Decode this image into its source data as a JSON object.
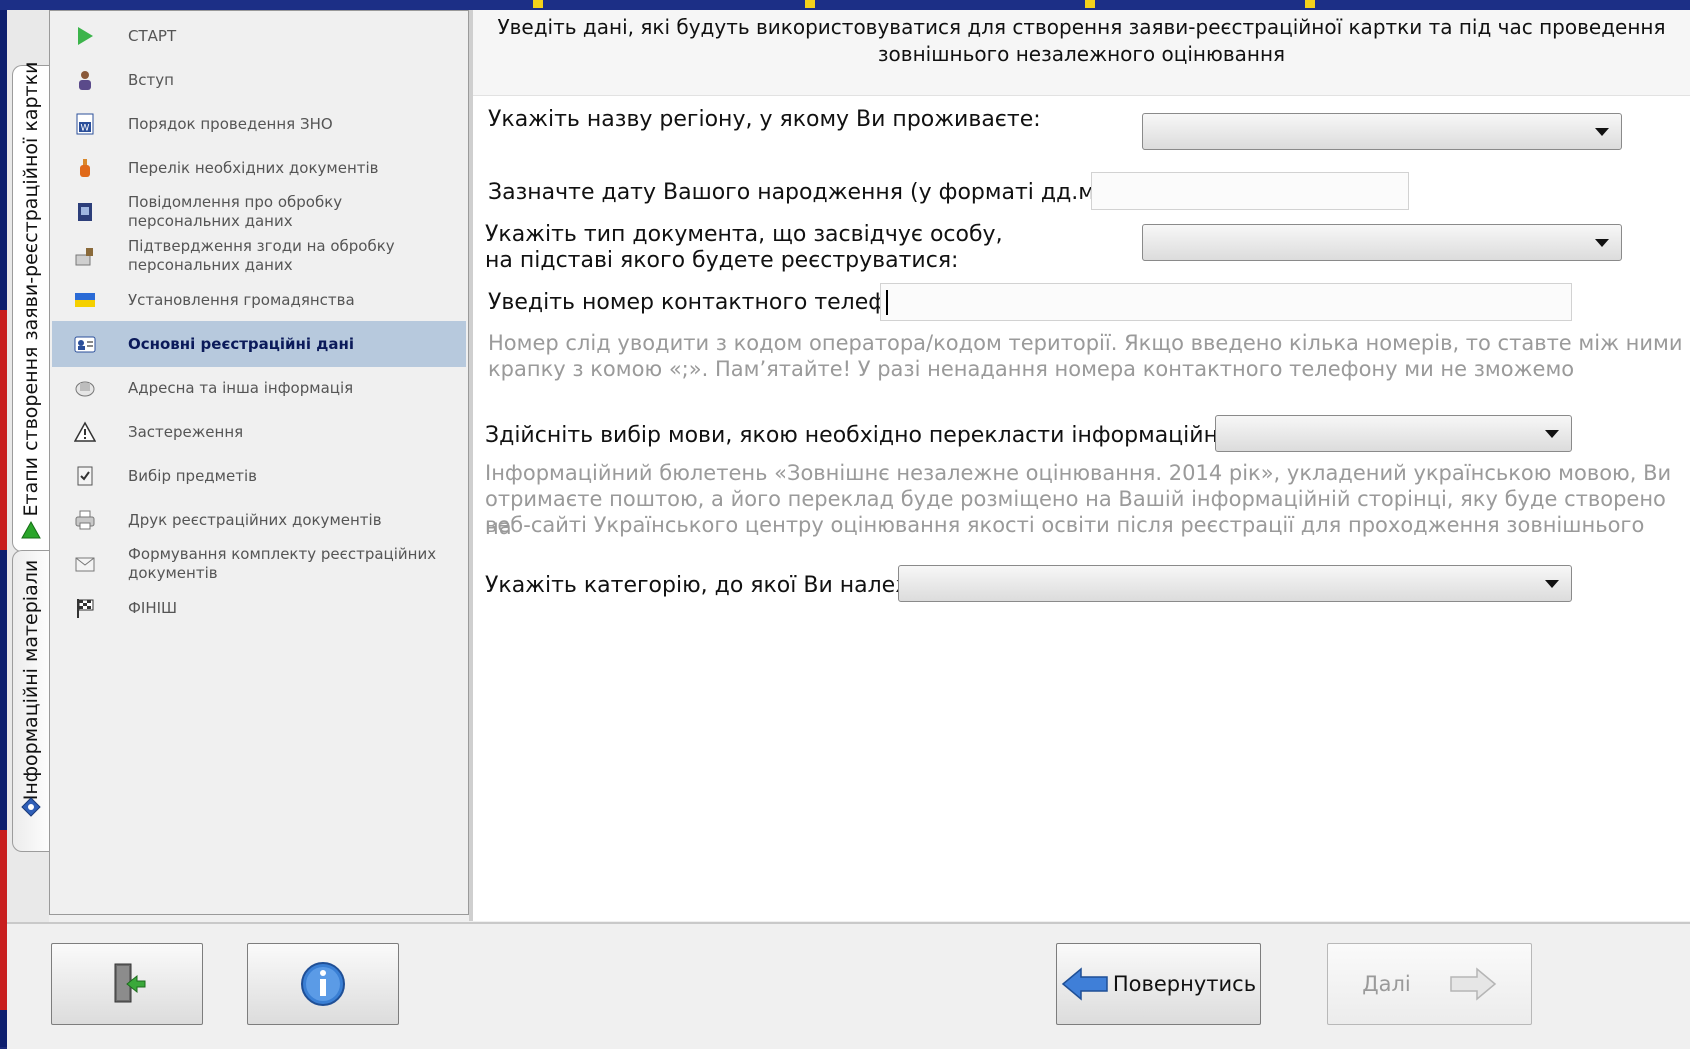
{
  "side_tabs": {
    "registration_stages": "Етапи створення заяви-реєстраційної картки",
    "info_materials": "Інформаційні матеріали"
  },
  "steps": [
    {
      "label": "СТАРТ",
      "icon": "play-icon"
    },
    {
      "label": "Вступ",
      "icon": "person-icon"
    },
    {
      "label": "Порядок проведення ЗНО",
      "icon": "word-document-icon"
    },
    {
      "label": "Перелік необхідних документів",
      "icon": "bottle-icon"
    },
    {
      "label": "Повідомлення про обробку персональних даних",
      "icon": "book-icon"
    },
    {
      "label": "Підтвердження згоди на обробку персональних даних",
      "icon": "stamp-icon"
    },
    {
      "label": "Установлення громадянства",
      "icon": "flag-icon"
    },
    {
      "label": "Основні реєстраційні дані",
      "icon": "id-card-icon"
    },
    {
      "label": "Адресна та інша інформація",
      "icon": "address-book-icon"
    },
    {
      "label": "Застереження",
      "icon": "warning-icon"
    },
    {
      "label": "Вибір предметів",
      "icon": "checklist-icon"
    },
    {
      "label": "Друк реєстраційних документів",
      "icon": "printer-icon"
    },
    {
      "label": "Формування комплекту реєстраційних документів",
      "icon": "envelope-icon"
    },
    {
      "label": "ФІНІШ",
      "icon": "checkered-flag-icon"
    }
  ],
  "active_step": "Основні реєстраційні дані",
  "form": {
    "header": "Уведіть дані, які будуть використовуватися для створення заяви-реєстраційної картки та під час проведення зовнішнього незалежного оцінювання",
    "region_label": "Укажіть назву регіону, у якому Ви проживаєте:",
    "region_value": "",
    "birthdate_label": "Зазначте дату Вашого народження (у форматі дд.мм.рррр):",
    "birthdate_value": "",
    "doc_type_label_1": "Укажіть тип документа, що засвідчує особу,",
    "doc_type_label_2": "на підставі якого будете реєструватися:",
    "doc_type_value": "",
    "phone_label": "Уведіть номер контактного телефону:",
    "phone_value": "",
    "phone_hint_1": "Номер слід уводити з кодом оператора/кодом території. Якщо введено кілька номерів, то ставте між ними",
    "phone_hint_2": "крапку з комою «;».  Пам’ятайте! У разі ненадання номера контактного телефону ми не зможемо",
    "language_label": "Здійсніть вибір мови, якою необхідно перекласти інформаційний бюлетень",
    "language_value": "",
    "language_hint_1": "Інформаційний бюлетень «Зовнішнє незалежне оцінювання. 2014 рік», укладений українською мовою, Ви",
    "language_hint_2": "отримаєте поштою, а його переклад буде розміщено на Вашій інформаційній сторінці, яку буде створено на",
    "language_hint_3": "веб-сайті Українського центру оцінювання якості освіти після реєстрації для проходження зовнішнього",
    "category_label": "Укажіть категорію, до якої Ви належите:",
    "category_value": ""
  },
  "buttons": {
    "exit_icon": "exit-door-icon",
    "info_icon": "info-icon",
    "back_label": "Повернутись",
    "next_label": "Далі"
  },
  "colors": {
    "active_step_bg": "#b7c9dd",
    "active_step_text": "#0b1a5a",
    "hint_text": "#9a9a9a"
  }
}
